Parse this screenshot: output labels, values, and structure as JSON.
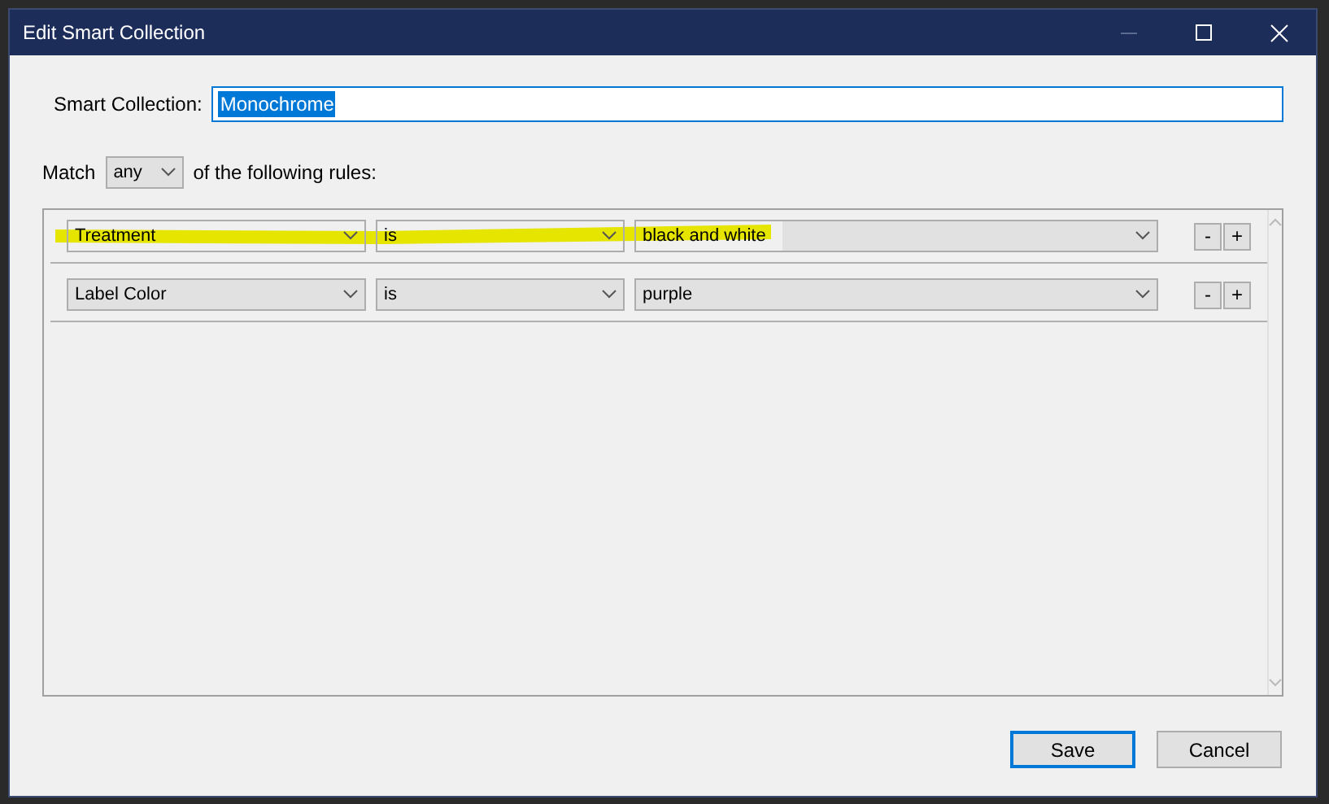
{
  "window": {
    "title": "Edit Smart Collection"
  },
  "name_field": {
    "label": "Smart Collection:",
    "value": "Monochrome"
  },
  "match": {
    "prefix": "Match",
    "value": "any",
    "suffix": "of the following rules:"
  },
  "rules": [
    {
      "field": "Treatment",
      "operator": "is",
      "value": "black and white",
      "highlighted": true,
      "remove": "-",
      "add": "+"
    },
    {
      "field": "Label Color",
      "operator": "is",
      "value": "purple",
      "highlighted": false,
      "remove": "-",
      "add": "+"
    }
  ],
  "buttons": [
    {
      "label": "Save",
      "default": true
    },
    {
      "label": "Cancel",
      "default": false
    }
  ]
}
